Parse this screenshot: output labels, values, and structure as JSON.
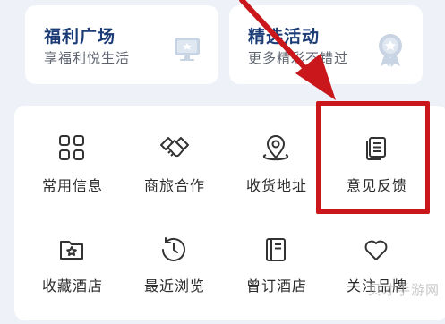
{
  "promos": [
    {
      "title": "福利广场",
      "subtitle": "享福利悦生活",
      "icon": "monitor-icon"
    },
    {
      "title": "精选活动",
      "subtitle": "更多精彩不错过",
      "icon": "medal-icon"
    }
  ],
  "grid": [
    {
      "label": "常用信息",
      "icon": "grid-icon"
    },
    {
      "label": "商旅合作",
      "icon": "handshake-icon"
    },
    {
      "label": "收货地址",
      "icon": "location-pin-icon"
    },
    {
      "label": "意见反馈",
      "icon": "feedback-document-icon"
    },
    {
      "label": "收藏酒店",
      "icon": "star-folder-icon"
    },
    {
      "label": "最近浏览",
      "icon": "history-clock-icon"
    },
    {
      "label": "曾订酒店",
      "icon": "booklet-icon"
    },
    {
      "label": "关注品牌",
      "icon": "heart-icon"
    }
  ],
  "watermark": "贝才手游网",
  "colors": {
    "highlight": "#c9171c",
    "promo_title": "#1c3c77",
    "background": "#eef2f8"
  }
}
